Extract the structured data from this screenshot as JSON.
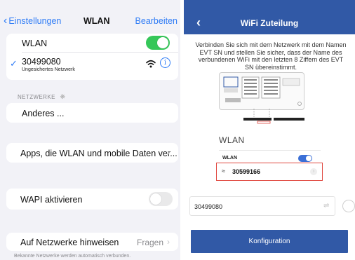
{
  "left": {
    "nav": {
      "back_label": "Einstellungen",
      "title": "WLAN",
      "edit_label": "Bearbeiten"
    },
    "wlan_row": {
      "label": "WLAN",
      "toggle_on": true
    },
    "connected_network": {
      "name": "30499080",
      "subtitle": "Ungesichertes Netzwerk"
    },
    "networks_section_label": "NETZWERKE",
    "other_network_label": "Anderes ...",
    "apps_row_label": "Apps, die WLAN und mobile Daten ver...",
    "wapi_row": {
      "label": "WAPI aktivieren",
      "toggle_on": false
    },
    "notify_row": {
      "label": "Auf Netzwerke hinweisen",
      "value": "Fragen"
    },
    "footnote": "Bekannte Netzwerke werden automatisch verbunden."
  },
  "right": {
    "title": "WiFi Zuteilung",
    "instruction": "Verbinden Sie sich mit dem Netzwerk mit dem Namen EVT SN und stellen Sie sicher, dass der Name des verbundenen WiFi mit den letzten 8 Ziffern des EVT SN übereinstimmt.",
    "illustration": {
      "big_label": "WLAN",
      "small_label": "WLAN",
      "network_name": "30599166",
      "highlight_color": "#e0473f"
    },
    "wifi_input_value": "30499080",
    "config_button_label": "Konfiguration",
    "accent_color": "#3159a6"
  }
}
